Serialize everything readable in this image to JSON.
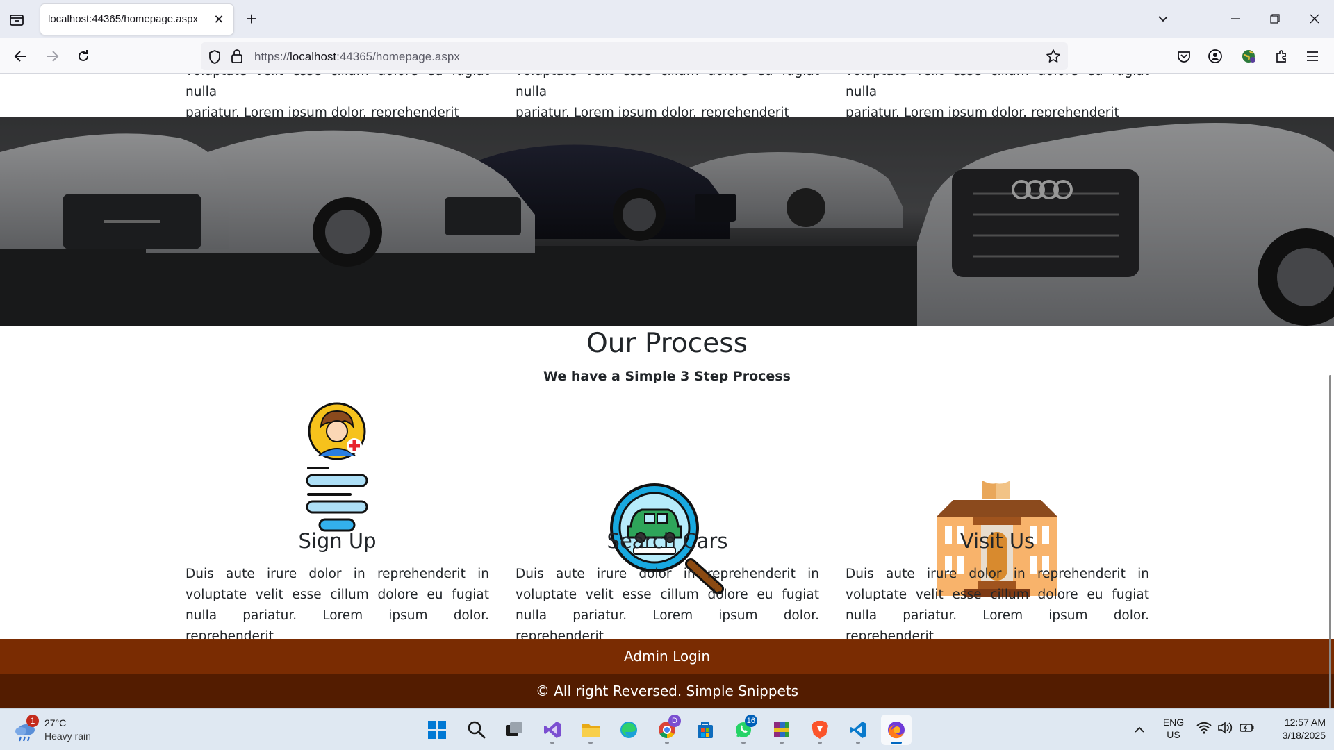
{
  "browser": {
    "tab_title": "localhost:44365/homepage.aspx",
    "url_prefix": "https://",
    "url_host": "localhost",
    "url_rest": ":44365/homepage.aspx"
  },
  "top_columns": [
    {
      "line1": "voluptate velit esse cillum dolore eu fugiat nulla",
      "line2": "pariatur. Lorem ipsum dolor. reprehenderit"
    },
    {
      "line1": "voluptate velit esse cillum dolore eu fugiat nulla",
      "line2": "pariatur. Lorem ipsum dolor. reprehenderit"
    },
    {
      "line1": "voluptate velit esse cillum dolore eu fugiat nulla",
      "line2": "pariatur. Lorem ipsum dolor. reprehenderit"
    }
  ],
  "process": {
    "title": "Our Process",
    "subtitle": "We have a Simple 3 Step Process",
    "steps": [
      {
        "title": "Sign Up",
        "icon": "signup-icon",
        "text": "Duis aute irure dolor in reprehenderit in voluptate velit esse cillum dolore eu fugiat nulla pariatur. Lorem ipsum dolor. reprehenderit"
      },
      {
        "title": "Search Cars",
        "icon": "car-search-icon",
        "text": "Duis aute irure dolor in reprehenderit in voluptate velit esse cillum dolore eu fugiat nulla pariatur. Lorem ipsum dolor. reprehenderit"
      },
      {
        "title": "Visit Us",
        "icon": "building-icon",
        "text": "Duis aute irure dolor in reprehenderit in voluptate velit esse cillum dolore eu fugiat nulla pariatur. Lorem ipsum dolor. reprehenderit"
      }
    ]
  },
  "footer": {
    "admin_login": "Admin Login",
    "copyright": "© All right Reversed. Simple Snippets"
  },
  "taskbar": {
    "weather_temp": "27°C",
    "weather_desc": "Heavy rain",
    "weather_badge": "1",
    "whatsapp_badge": "16",
    "chrome_badge": "D",
    "lang_line1": "ENG",
    "lang_line2": "US",
    "time": "12:57 AM",
    "date": "3/18/2025"
  },
  "colors": {
    "admin_bar": "#7a2c02",
    "footer_bar": "#531c00",
    "taskbar": "#dfe8f2"
  }
}
